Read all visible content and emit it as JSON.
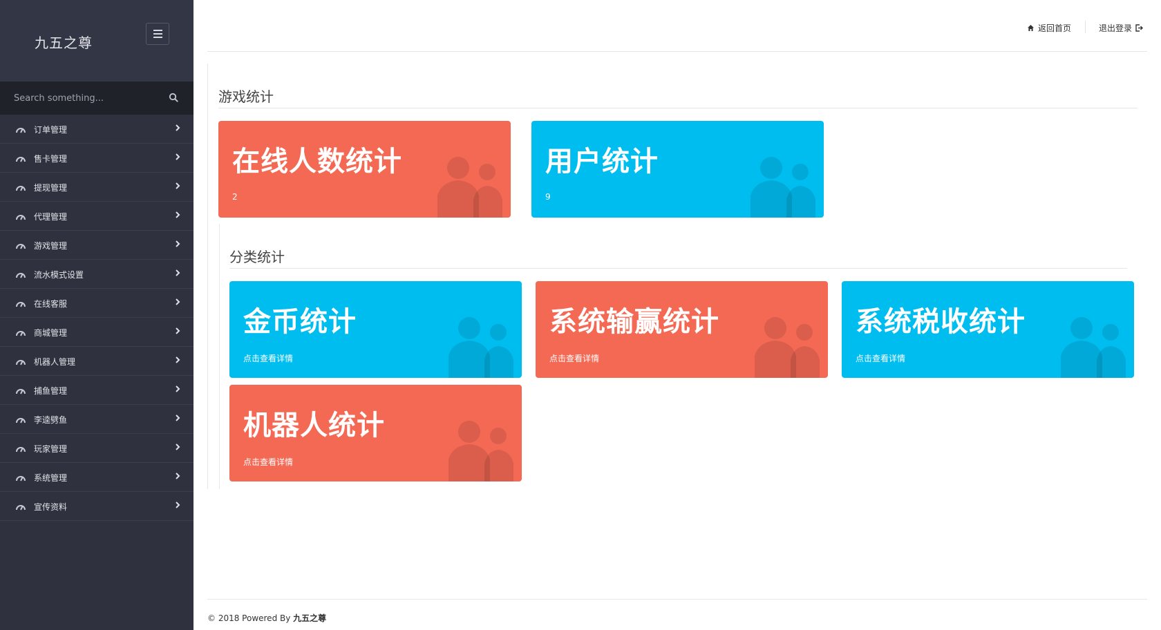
{
  "sidebar": {
    "brand": "九五之尊",
    "search_placeholder": "Search something...",
    "items": [
      {
        "label": "订单管理"
      },
      {
        "label": "售卡管理"
      },
      {
        "label": "提现管理"
      },
      {
        "label": "代理管理"
      },
      {
        "label": "游戏管理"
      },
      {
        "label": "流水模式设置"
      },
      {
        "label": "在线客服"
      },
      {
        "label": "商城管理"
      },
      {
        "label": "机器人管理"
      },
      {
        "label": "捕鱼管理"
      },
      {
        "label": "李逵劈鱼"
      },
      {
        "label": "玩家管理"
      },
      {
        "label": "系统管理"
      },
      {
        "label": "宣传资料"
      }
    ]
  },
  "header": {
    "home_label": "返回首页",
    "logout_label": "退出登录"
  },
  "game_stats": {
    "title": "游戏统计",
    "cards": [
      {
        "title": "在线人数统计",
        "value": "2",
        "color": "red"
      },
      {
        "title": "用户统计",
        "value": "9",
        "color": "blue"
      }
    ]
  },
  "category_stats": {
    "title": "分类统计",
    "cards": [
      {
        "title": "金币统计",
        "sub": "点击查看详情",
        "color": "blue"
      },
      {
        "title": "系统输赢统计",
        "sub": "点击查看详情",
        "color": "red"
      },
      {
        "title": "系统税收统计",
        "sub": "点击查看详情",
        "color": "blue"
      },
      {
        "title": "机器人统计",
        "sub": "点击查看详情",
        "color": "red"
      }
    ]
  },
  "footer": {
    "prefix": "© 2018 Powered By",
    "brand": "九五之尊"
  },
  "colors": {
    "sidebar_bg": "#2f323e",
    "card_red": "#f36954",
    "card_blue": "#00bdf0"
  }
}
